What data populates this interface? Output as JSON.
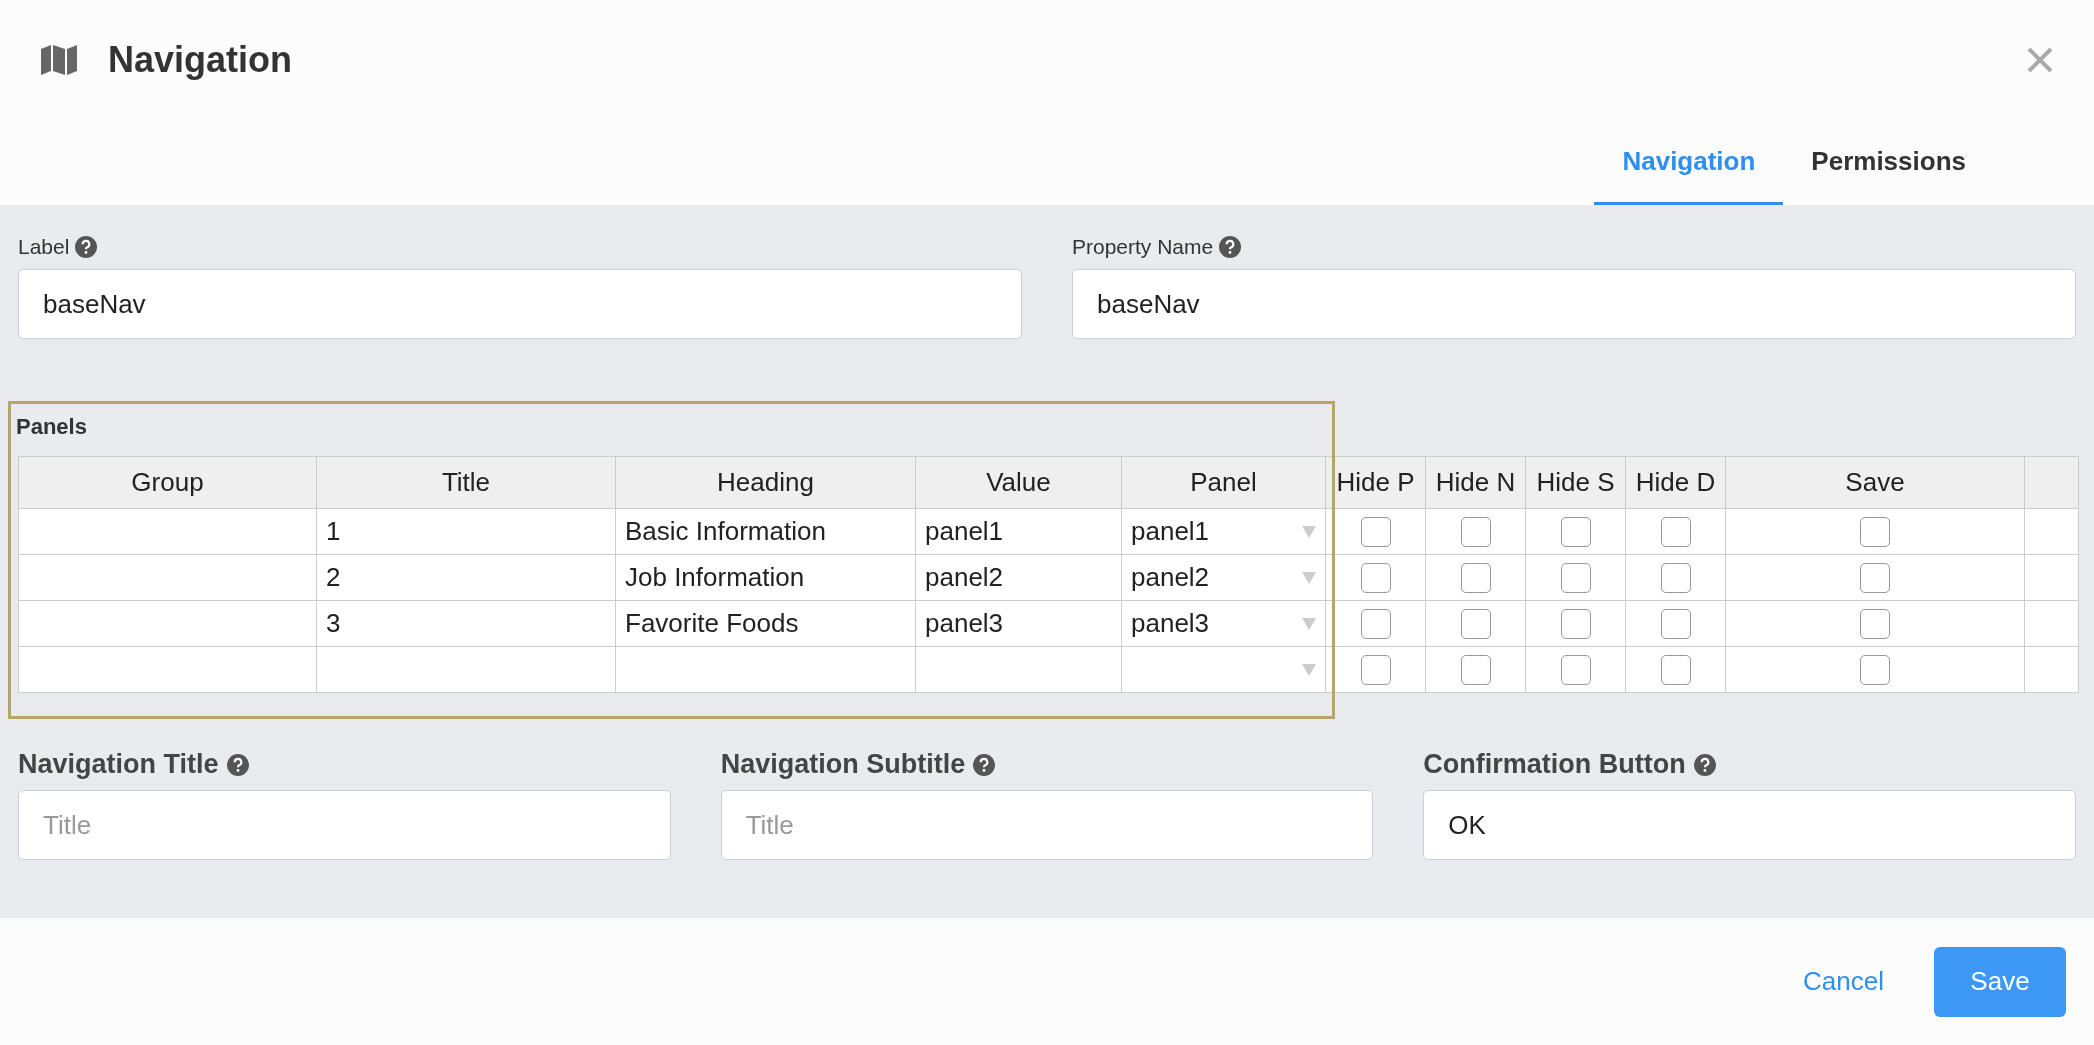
{
  "dialog": {
    "title": "Navigation"
  },
  "tabs": [
    {
      "label": "Navigation",
      "selected": true
    },
    {
      "label": "Permissions",
      "selected": false
    }
  ],
  "fields": [
    {
      "label": "Label",
      "value": "baseNav"
    },
    {
      "label": "Property Name",
      "value": "baseNav"
    }
  ],
  "panels": {
    "title": "Panels",
    "columns": [
      "Group",
      "Title",
      "Heading",
      "Value",
      "Panel",
      "Hide P",
      "Hide N",
      "Hide S",
      "Hide D",
      "Save"
    ],
    "rows": [
      {
        "title": "1",
        "heading": "Basic Information",
        "value": "panel1",
        "panel": "panel1",
        "checks": [
          false,
          false,
          false,
          false,
          false
        ]
      },
      {
        "title": "2",
        "heading": "Job Information",
        "value": "panel2",
        "panel": "panel2",
        "checks": [
          false,
          false,
          false,
          false,
          false
        ]
      },
      {
        "title": "3",
        "heading": "Favorite Foods",
        "value": "panel3",
        "panel": "panel3",
        "checks": [
          false,
          false,
          false,
          false,
          false
        ]
      },
      {
        "checks": [
          false,
          false,
          false,
          false,
          false
        ]
      }
    ]
  },
  "bottom_fields": [
    {
      "label": "Navigation Title",
      "placeholder": "Title"
    },
    {
      "label": "Navigation Subtitle",
      "placeholder": "Title"
    },
    {
      "label": "Confirmation Button",
      "value": "OK"
    }
  ],
  "buttons": {
    "cancel": "Cancel",
    "save": "Save"
  }
}
